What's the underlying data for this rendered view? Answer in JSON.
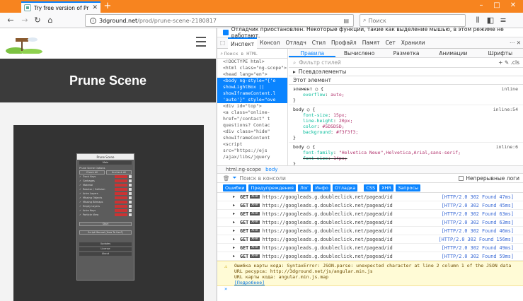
{
  "browser": {
    "tab_title": "Try free version of Prune Scene",
    "url_host": "3dground.net",
    "url_path": "/prod/prune-scene-2180817",
    "search_placeholder": "Поиск"
  },
  "page": {
    "hero_title": "Prune Scene"
  },
  "plugin": {
    "title": "Prune Scene",
    "main_label": "Main",
    "options_label": "Prune Scene Options",
    "check_all": "Check All",
    "uncheck_all": "Uncheck All",
    "rows": [
      "Track Keys",
      "Garbages",
      "Material",
      "Reactor / Collision",
      "Anim Layers",
      "Missing Objects",
      "Missing Bitmaps",
      "Empty Layers",
      "Anim Keys",
      "Particle View"
    ],
    "row_value": "CLEANED",
    "start_label": "Start",
    "manual_label": "Script Manual (How To Use?)",
    "updates_label": "Updates",
    "license_label": "License",
    "about_label": "About"
  },
  "devtools": {
    "paused_message": "Отладчик приостановлен. Некоторые функции, такие как выделение мышью, в этом режиме не работают.",
    "tabs": [
      "Инспект",
      "Консол",
      "Отладч",
      "Стил",
      "Профайл",
      "Памят",
      "Сет",
      "Хранили"
    ],
    "node_search": "Поиск в HTML",
    "dom_lines": [
      {
        "text": "<!DOCTYPE html>",
        "selected": false
      },
      {
        "text": "<html class=\"ng-scope\">",
        "selected": false
      },
      {
        "text": "<head lang=\"en\">",
        "selected": false
      },
      {
        "text": "<body ng-style=\"{'o",
        "selected": true
      },
      {
        "text": "showLightBox ||",
        "selected": true
      },
      {
        "text": "showIframeContent.l",
        "selected": true
      },
      {
        "text": "'auto'}\" style=\"ove",
        "selected": true
      },
      {
        "text": "<div id=\"top\">",
        "selected": false
      },
      {
        "text": "<a class=\"online-",
        "selected": false
      },
      {
        "text": "href=\"/contact\" t",
        "selected": false
      },
      {
        "text": "questions? Contac",
        "selected": false
      },
      {
        "text": "<div class=\"hide\"",
        "selected": false
      },
      {
        "text": "showIframeContent",
        "selected": false
      },
      {
        "text": "<script",
        "selected": false
      },
      {
        "text": "src=\"https://ejs",
        "selected": false
      },
      {
        "text": "/ajax/libs/jquery",
        "selected": false
      }
    ],
    "rule_tabs": [
      "Правила",
      "Вычислено",
      "Разметка",
      "Анимации",
      "Шрифты"
    ],
    "filter_placeholder": "Фильтр стилей",
    "pseudo_label": "Псевдоэлементы",
    "this_element": "Этот элемент",
    "rules": [
      {
        "selector": "элемент",
        "source": "inline",
        "props": [
          {
            "name": "overflow",
            "value": "auto;",
            "strike": false
          }
        ]
      },
      {
        "selector": "body",
        "source": "inline:54",
        "props": [
          {
            "name": "font-size",
            "value": "15px;",
            "strike": false
          },
          {
            "name": "line-height",
            "value": "20px;",
            "strike": false
          },
          {
            "name": "color",
            "value": "#5D5D5D;",
            "strike": false
          },
          {
            "name": "background",
            "value": "#f3f3f3;",
            "strike": false
          }
        ]
      },
      {
        "selector": "body",
        "source": "inline:6",
        "props": [
          {
            "name": "font-family",
            "value": "\"Helvetica Neue\",Helvetica,Arial,sans-serif;",
            "strike": false
          },
          {
            "name": "font-size",
            "value": "14px;",
            "strike": true
          }
        ]
      }
    ],
    "breadcrumbs": [
      "html.ng-scope",
      "body"
    ],
    "console_filter_placeholder": "Поиск в консоли",
    "persist_logs": "Непрерывные логи",
    "filter_buttons": [
      "Ошибки",
      "Предупреждения",
      "Лог",
      "Инфо",
      "Отладка",
      "CSS",
      "XHR",
      "Запросы"
    ],
    "requests": [
      {
        "method": "GET",
        "url": "https://googleads.g.doubleclick.net/pagead/id",
        "status": "[HTTP/2.0 302 Found 47ms]"
      },
      {
        "method": "GET",
        "url": "https://googleads.g.doubleclick.net/pagead/id",
        "status": "[HTTP/2.0 302 Found 45ms]"
      },
      {
        "method": "GET",
        "url": "https://googleads.g.doubleclick.net/pagead/id",
        "status": "[HTTP/2.0 302 Found 63ms]"
      },
      {
        "method": "GET",
        "url": "https://googleads.g.doubleclick.net/pagead/id",
        "status": "[HTTP/2.0 302 Found 63ms]"
      },
      {
        "method": "GET",
        "url": "https://googleads.g.doubleclick.net/pagead/id",
        "status": "[HTTP/2.0 302 Found 46ms]"
      },
      {
        "method": "GET",
        "url": "https://googleads.g.doubleclick.net/pagead/id",
        "status": "[HTTP/2.0 302 Found 156ms]"
      },
      {
        "method": "GET",
        "url": "https://googleads.g.doubleclick.net/pagead/id",
        "status": "[HTTP/2.0 302 Found 49ms]"
      },
      {
        "method": "GET",
        "url": "https://googleads.g.doubleclick.net/pagead/id",
        "status": "[HTTP/2.0 302 Found 59ms]"
      }
    ],
    "warning": {
      "line1": "Ошибка карты кода: SyntaxError: JSON.parse: unexpected character at line 2 column 1 of the JSON data",
      "line2": "URL ресурса: http://3dground.net/js/angular.min.js",
      "line3": "URL карты кода: angular.min.js.map",
      "more": "[Подробнее]"
    }
  }
}
